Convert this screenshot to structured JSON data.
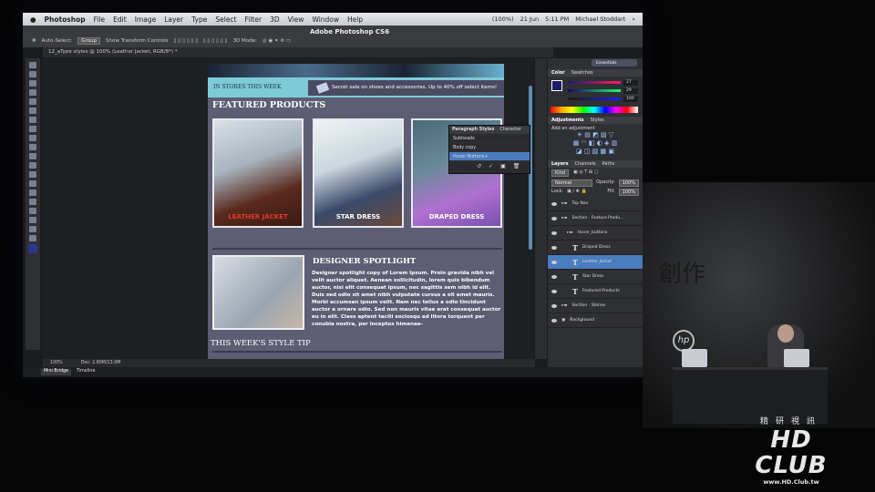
{
  "menubar": {
    "app": "Photoshop",
    "items": [
      "File",
      "Edit",
      "Image",
      "Layer",
      "Type",
      "Select",
      "Filter",
      "3D",
      "View",
      "Window",
      "Help"
    ],
    "battery": "(100%)",
    "date": "21 Jun",
    "time": "5:11 PM",
    "user": "Michael Stoddart"
  },
  "options": {
    "title": "Adobe Photoshop CS6",
    "auto_select": "Auto-Select:",
    "group": "Group",
    "transform": "Show Transform Controls",
    "mode3d": "3D Mode:"
  },
  "tab": {
    "label": "12_aType styles @ 100% (Leather Jacket, RGB/8*) *"
  },
  "doc": {
    "banner_left": "IN STORES THIS WEEK",
    "banner_right": "Secret sale on shoes and accessories. Up to 40% off select items!",
    "featured": "FEATURED PRODUCTS",
    "products": [
      "LEATHER JACKET",
      "STAR DRESS",
      "DRAPED DRESS"
    ],
    "spot_head": "DESIGNER SPOTLIGHT",
    "spot_text": "Designer spotlight copy of Lorem Ipsum. Proin gravida nibh vel velit auctor aliquet. Aenean sollicitudin, lorem quis bibendum auctor, nisi elit consequat ipsum, nec sagittis sem nibh id elit. Duis sed odio sit amet nibh vulputate cursus a sit amet mauris. Morbi accumsan ipsum velit. Nam nec tellus a odio tincidunt auctor a ornare odio. Sed non mauris vitae erat consequat auctor eu in elit. Class aptent taciti sociosqu ad litora torquent per conubia nostra, per inceptos himenae-",
    "style_tip": "THIS WEEK'S STYLE TIP"
  },
  "pstyles": {
    "tabs": [
      "Paragraph Styles",
      "Character"
    ],
    "items": [
      "Subheads",
      "Body copy",
      "Hover Buttons+"
    ]
  },
  "panels": {
    "workspace": "Essentials",
    "color_tabs": [
      "Color",
      "Swatches"
    ],
    "r": "27",
    "g": "29",
    "b": "100",
    "adj_tabs": [
      "Adjustments",
      "Styles"
    ],
    "adj_label": "Add an adjustment",
    "layer_tabs": [
      "Layers",
      "Channels",
      "Paths"
    ],
    "kind": "Kind",
    "blend": "Normal",
    "opacity_label": "Opacity:",
    "opacity": "100%",
    "lock": "Lock:",
    "fill_label": "Fill:",
    "fill": "100%",
    "layers": [
      {
        "name": "Top Nav",
        "type": "folder"
      },
      {
        "name": "Section - Feature Produ...",
        "type": "folder"
      },
      {
        "name": "Hover_buttons",
        "type": "folder"
      },
      {
        "name": "Draped Dress",
        "type": "text"
      },
      {
        "name": "Leather Jacket",
        "type": "text",
        "selected": true
      },
      {
        "name": "Star Dress",
        "type": "text"
      },
      {
        "name": "Featured Products",
        "type": "text"
      },
      {
        "name": "Section - Stories",
        "type": "folder"
      },
      {
        "name": "Background",
        "type": "image"
      }
    ]
  },
  "status": {
    "zoom": "100%",
    "doc": "Doc: 2.80M/13.0M"
  },
  "bottom_tabs": [
    "Mini Bridge",
    "Timeline"
  ],
  "stage": {
    "sign": "創作",
    "logo": "hp"
  },
  "watermark": {
    "cn": "精研視訊",
    "brand": "HD CLUB",
    "url": "www.HD.Club.tw"
  }
}
